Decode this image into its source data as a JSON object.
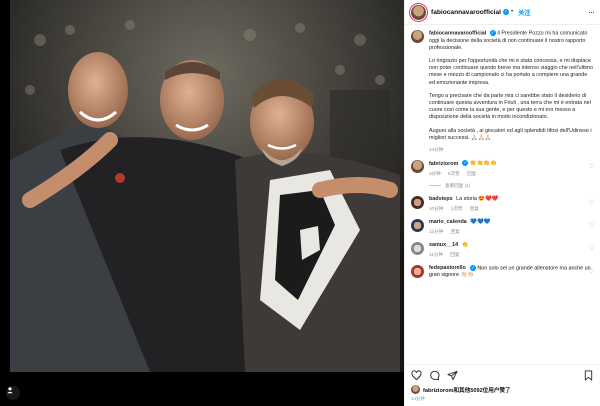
{
  "post": {
    "username": "fabiocannavaroofficial",
    "follow_label": "关注",
    "more_label": "···",
    "caption": {
      "username": "fabiocannavaroofficial",
      "paragraphs": [
        "Il Presidente Pozzo mi ha comunicato oggi la decisione della società di non continuare il nostro rapporto professionale.",
        "Lo ringrazio per l'opportunità che mi è stata concessa, e mi dispiace non poter continuare questo breve ma intenso viaggio che nell'ultimo mese e mezzo di campionato ci ha portato a compiere una grande ed emozionante impresa.",
        "Tengo a precisare che da parte mia ci sarebbe stato il desiderio di continuare questa avventura in Friuli , una terra che mi è entrata nel cuore così come la sua gente, e per questo e mi ero messo a disposizione della società in modo incondizionato.",
        "Auguro alla società , ai giocatori ed agli splendidi tifosi dell'Udinese i migliori successi. 🙏🏻🙏🏻🙏🏻"
      ],
      "time": "14分钟"
    },
    "comments": [
      {
        "username": "fabriziorom",
        "verified": true,
        "text": "👏👏👏👏",
        "time": "3分钟",
        "likes": "8次赞",
        "reply": "回复",
        "view_replies": "查看回复 (1)"
      },
      {
        "username": "badsteps",
        "verified": false,
        "text": "La storia 😍❤️❤️",
        "time": "10分钟",
        "likes": "1次赞",
        "reply": "回复"
      },
      {
        "username": "mario_calenda",
        "verified": false,
        "text": "💙💙💙",
        "time": "12分钟",
        "likes": "",
        "reply": "回复"
      },
      {
        "username": "samux__14",
        "verified": false,
        "text": "👏",
        "time": "11分钟",
        "likes": "",
        "reply": "回复"
      },
      {
        "username": "fedepastorello",
        "verified": true,
        "text": "Non solo sei un grande allenatore ma anche un gran signore 👏🏻👏🏻",
        "time": "",
        "likes": "",
        "reply": ""
      }
    ],
    "likes_text": "fabriziorom和其他5092位用户赞了",
    "posted_ago": "14分钟"
  },
  "colors": {
    "accent": "#0095f6",
    "story_ring": "#e1306c",
    "muted": "#8e8e8e"
  },
  "icons": [
    "heart-icon",
    "comment-icon",
    "share-icon",
    "bookmark-icon",
    "more-icon",
    "user-tag-icon"
  ]
}
